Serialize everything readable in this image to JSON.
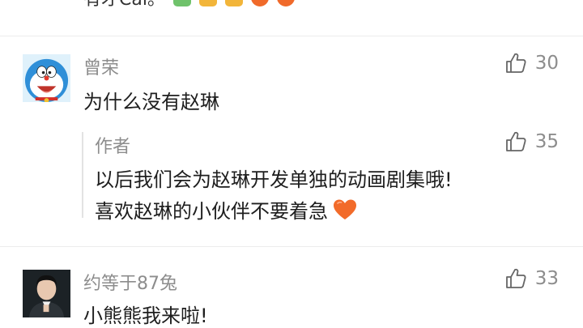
{
  "top_partial": {
    "text": "有才Cal。"
  },
  "comments": [
    {
      "username": "曾荣",
      "text": "为什么没有赵琳",
      "likes": "30"
    },
    {
      "username": "约等于87兔",
      "text": "小熊熊我来啦!",
      "likes": "33"
    }
  ],
  "reply": {
    "author": "作者",
    "line1": "以后我们会为赵琳开发单独的动画剧集哦!",
    "line2": "喜欢赵琳的小伙伴不要着急",
    "likes": "35"
  },
  "colors": {
    "username": "#8d8d8d",
    "text": "#1e1e1e",
    "divider": "#ececec",
    "heart": "#f26b2a"
  }
}
